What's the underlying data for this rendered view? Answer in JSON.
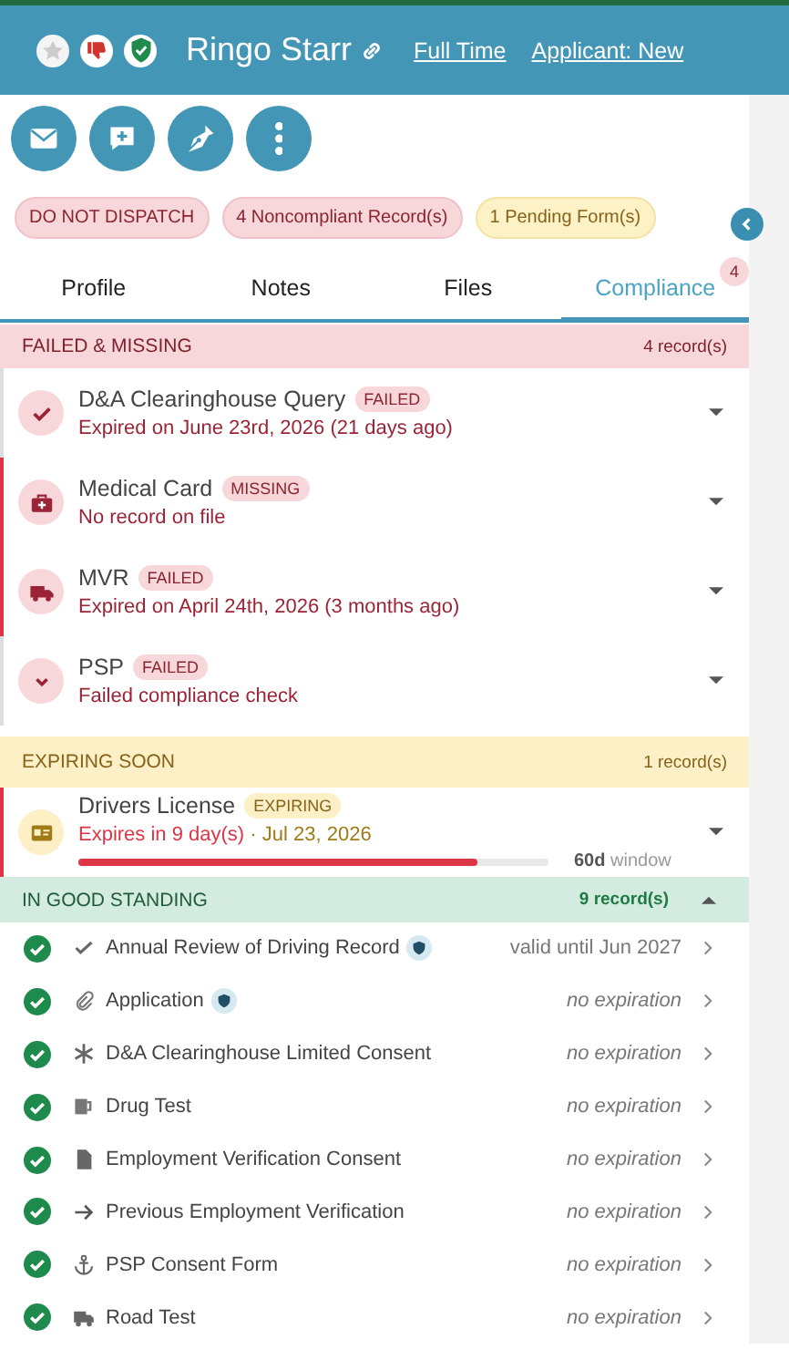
{
  "header": {
    "name": "Ringo Starr",
    "links": [
      "Full Time",
      "Applicant: New"
    ]
  },
  "badges": [
    {
      "label": "DO NOT DISPATCH",
      "kind": "danger"
    },
    {
      "label": "4 Noncompliant Record(s)",
      "kind": "danger"
    },
    {
      "label": "1 Pending Form(s)",
      "kind": "warning"
    }
  ],
  "tabs": [
    {
      "label": "Profile",
      "selected": false
    },
    {
      "label": "Notes",
      "selected": false
    },
    {
      "label": "Files",
      "selected": false
    },
    {
      "label": "Compliance",
      "selected": true,
      "count": "4"
    }
  ],
  "sections": [
    {
      "title": "FAILED & MISSING",
      "count": "4 record(s)",
      "kind": "failed",
      "items": [
        {
          "name": "D&A Clearinghouse Query",
          "status": "FAILED",
          "detail": "Expired on June 23rd, 2026 (21 days ago)",
          "flagged": false
        },
        {
          "name": "Medical Card",
          "status": "MISSING",
          "detail": "No record on file",
          "flagged": true
        },
        {
          "name": "MVR",
          "status": "FAILED",
          "detail": "Expired on April 24th, 2026 (3 months ago)",
          "flagged": true
        },
        {
          "name": "PSP",
          "status": "FAILED",
          "detail": "Failed compliance check",
          "flagged": false
        }
      ]
    },
    {
      "title": "EXPIRING SOON",
      "count": "1 record(s)",
      "kind": "expiring",
      "items": [
        {
          "name": "Drivers License",
          "status": "EXPIRING",
          "detail_alert": "Expires in 9 day(s)",
          "detail": "· Jul 23, 2026",
          "level": 0.85,
          "window": "60d",
          "window_label": "window",
          "flagged": true
        }
      ]
    },
    {
      "title": "IN GOOD STANDING",
      "count": "9 record(s)",
      "kind": "good",
      "expanded": true,
      "items": [
        {
          "name": "Annual Review of Driving Record",
          "verified": true,
          "expiry": "valid until Jun 2027"
        },
        {
          "name": "Application",
          "verified": true,
          "expiry": "no expiration"
        },
        {
          "name": "D&A Clearinghouse Limited Consent",
          "verified": false,
          "expiry": "no expiration"
        },
        {
          "name": "Drug Test",
          "verified": false,
          "expiry": "no expiration"
        },
        {
          "name": "Employment Verification Consent",
          "verified": false,
          "expiry": "no expiration"
        },
        {
          "name": "Previous Employment Verification",
          "verified": false,
          "expiry": "no expiration"
        },
        {
          "name": "PSP Consent Form",
          "verified": false,
          "expiry": "no expiration"
        },
        {
          "name": "Road Test",
          "verified": false,
          "expiry": "no expiration"
        }
      ]
    }
  ]
}
